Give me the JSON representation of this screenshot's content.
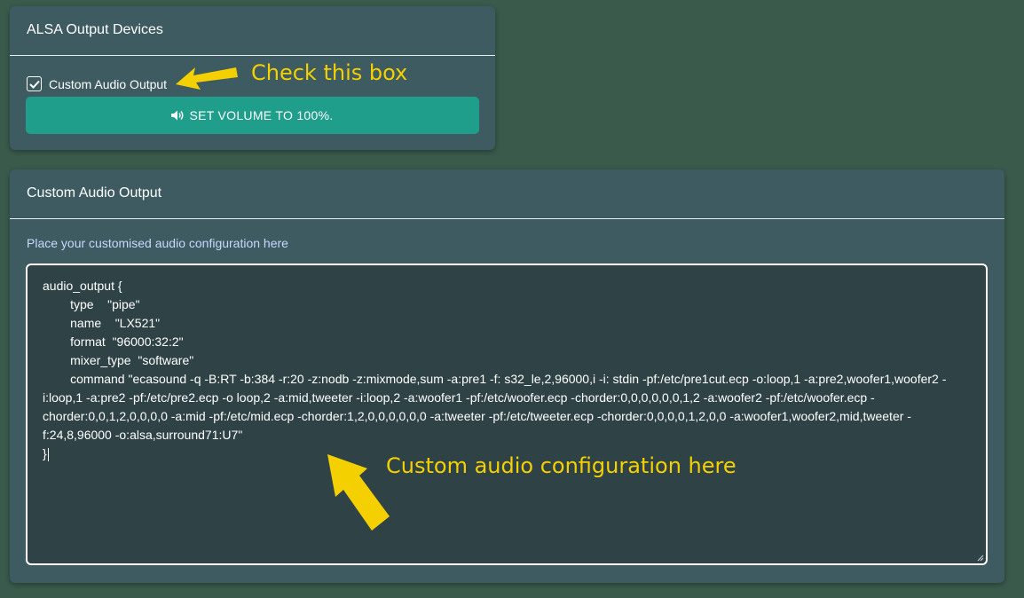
{
  "alsa_card": {
    "title": "ALSA Output Devices",
    "checkbox_label": "Custom Audio Output",
    "checkbox_checked": true,
    "volume_button_label": "SET VOLUME TO 100%.",
    "volume_icon": "volume-up-icon"
  },
  "custom_card": {
    "title": "Custom Audio Output",
    "helper_text": "Place your customised audio configuration here",
    "config_lines": [
      "audio_output {",
      "        type    \"pipe\"",
      "        name    \"LX521\"",
      "        format  \"96000:32:2\"",
      "        mixer_type  \"software\"",
      "        command \"ecasound -q -B:RT -b:384 -r:20 -z:nodb -z:mixmode,sum -a:pre1 -f: s32_le,2,96000,i -i: stdin -pf:/etc/pre1cut.ecp -o:loop,1 -a:pre2,woofer1,woofer2 -",
      "i:loop,1 -a:pre2 -pf:/etc/pre2.ecp -o loop,2 -a:mid,tweeter -i:loop,2 -a:woofer1 -pf:/etc/woofer.ecp -chorder:0,0,0,0,0,0,1,2 -a:woofer2 -pf:/etc/woofer.ecp -",
      "chorder:0,0,1,2,0,0,0,0 -a:mid -pf:/etc/mid.ecp -chorder:1,2,0,0,0,0,0,0 -a:tweeter -pf:/etc/tweeter.ecp -chorder:0,0,0,0,1,2,0,0 -a:woofer1,woofer2,mid,tweeter -",
      "f:24,8,96000 -o:alsa,surround71:U7\"",
      "}"
    ]
  },
  "annotations": {
    "check_box_callout": "Check this box",
    "config_callout": "Custom audio configuration here",
    "color": "#f5d000"
  }
}
